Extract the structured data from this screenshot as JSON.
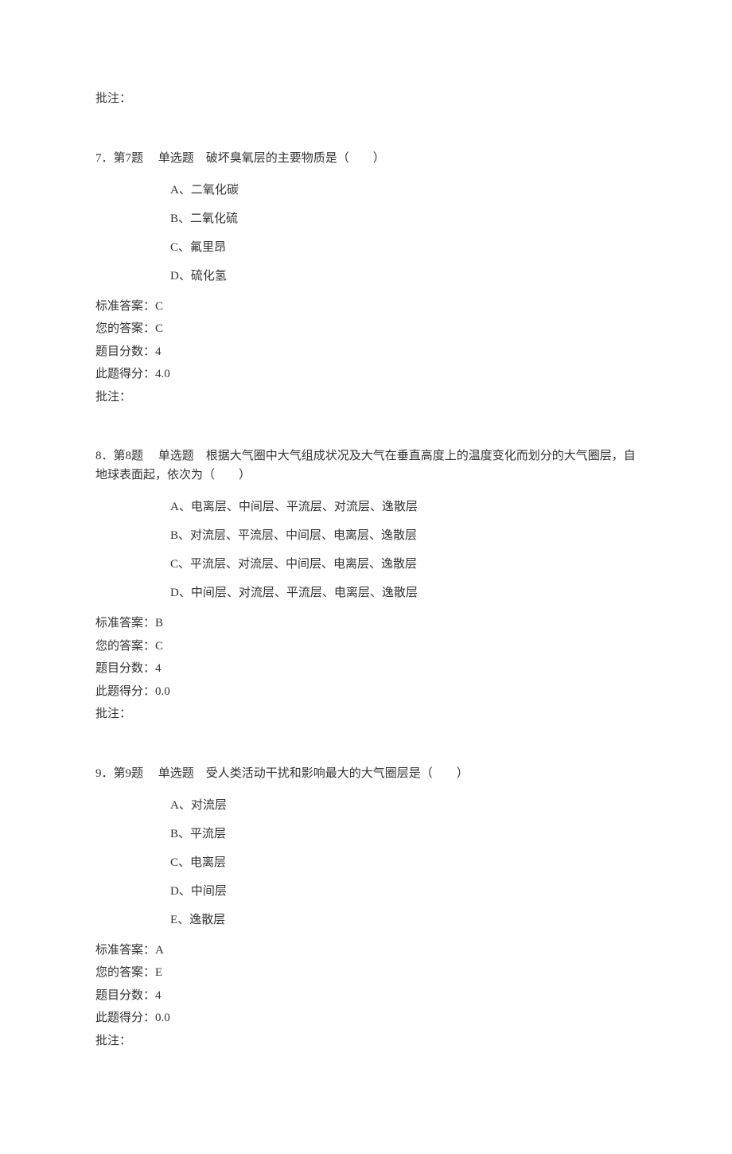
{
  "top_remark": "批注：",
  "questions": [
    {
      "stem": "7．第7题　 单选题　破坏臭氧层的主要物质是（　　）",
      "options": [
        "A、二氧化碳",
        "B、二氧化硫",
        "C、氟里昂",
        "D、硫化氢"
      ],
      "standard_answer_label": "标准答案：",
      "standard_answer_value": "C",
      "your_answer_label": "您的答案：",
      "your_answer_value": "C",
      "score_label": "题目分数：",
      "score_value": "4",
      "got_label": "此题得分：",
      "got_value": "4.0",
      "remark_label": "批注："
    },
    {
      "stem": "8．第8题　 单选题　根据大气圈中大气组成状况及大气在垂直高度上的温度变化而划分的大气圈层，自地球表面起，依次为（　　）",
      "options": [
        "A、电离层、中间层、平流层、对流层、逸散层",
        "B、对流层、平流层、中间层、电离层、逸散层",
        "C、平流层、对流层、中间层、电离层、逸散层",
        "D、中间层、对流层、平流层、电离层、逸散层"
      ],
      "standard_answer_label": "标准答案：",
      "standard_answer_value": "B",
      "your_answer_label": "您的答案：",
      "your_answer_value": "C",
      "score_label": "题目分数：",
      "score_value": "4",
      "got_label": "此题得分：",
      "got_value": "0.0",
      "remark_label": "批注："
    },
    {
      "stem": "9．第9题　 单选题　受人类活动干扰和影响最大的大气圈层是（　　）",
      "options": [
        "A、对流层",
        "B、平流层",
        "C、电离层",
        "D、中间层",
        "E、逸散层"
      ],
      "standard_answer_label": "标准答案：",
      "standard_answer_value": "A",
      "your_answer_label": "您的答案：",
      "your_answer_value": "E",
      "score_label": "题目分数：",
      "score_value": "4",
      "got_label": "此题得分：",
      "got_value": "0.0",
      "remark_label": "批注："
    }
  ]
}
